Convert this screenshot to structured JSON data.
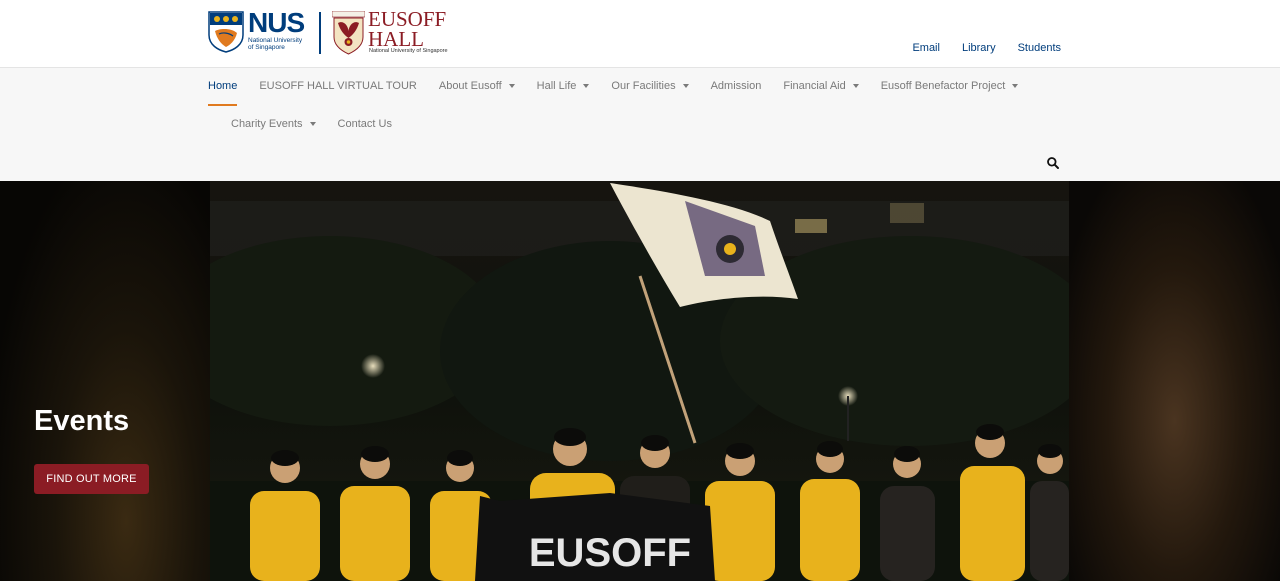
{
  "header": {
    "nus_logo": {
      "name": "NUS",
      "subtitle_line1": "National University",
      "subtitle_line2": "of Singapore"
    },
    "eusoff_logo": {
      "name_line1": "EUSOFF",
      "name_line2": "HALL",
      "subtitle": "National University of Singapore"
    },
    "quick_links": [
      {
        "label": "Email"
      },
      {
        "label": "Library"
      },
      {
        "label": "Students"
      }
    ]
  },
  "nav": {
    "row1": [
      {
        "label": "Home",
        "active": true,
        "dropdown": false
      },
      {
        "label": "EUSOFF HALL VIRTUAL TOUR",
        "dropdown": false
      },
      {
        "label": "About Eusoff",
        "dropdown": true
      },
      {
        "label": "Hall Life",
        "dropdown": true
      },
      {
        "label": "Our Facilities",
        "dropdown": true
      },
      {
        "label": "Admission",
        "dropdown": false
      },
      {
        "label": "Financial Aid",
        "dropdown": true
      },
      {
        "label": "Eusoff Benefactor Project",
        "dropdown": true
      }
    ],
    "row2": [
      {
        "label": "Charity Events",
        "dropdown": true
      },
      {
        "label": "Contact Us",
        "dropdown": false
      }
    ],
    "search_icon": "search-icon"
  },
  "hero": {
    "title": "Events",
    "button_label": "FIND OUT MORE",
    "flag_text": "EUSOFF"
  },
  "colors": {
    "brand_blue": "#003d7c",
    "brand_maroon": "#8b1c24",
    "active_underline": "#e07a1f",
    "shirt_yellow": "#e8b21c"
  }
}
